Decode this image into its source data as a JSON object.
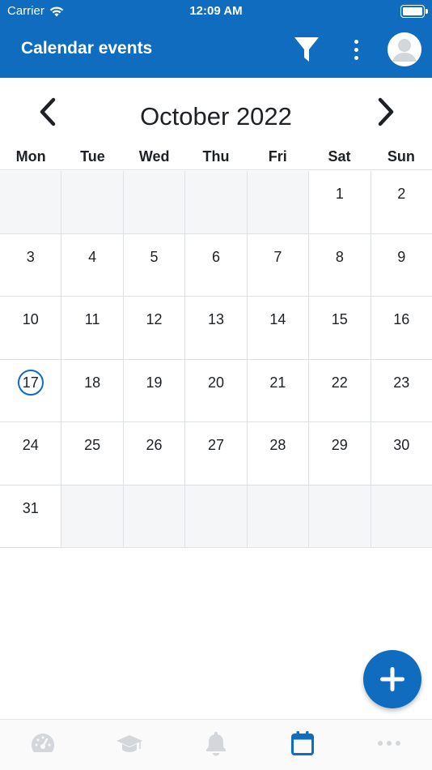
{
  "status_bar": {
    "carrier": "Carrier",
    "time": "12:09 AM"
  },
  "app_bar": {
    "title": "Calendar events",
    "icons": [
      "filter-icon",
      "more-vertical-icon",
      "user-avatar"
    ]
  },
  "calendar": {
    "month_label": "October 2022",
    "weekdays": [
      "Mon",
      "Tue",
      "Wed",
      "Thu",
      "Fri",
      "Sat",
      "Sun"
    ],
    "weeks": [
      [
        "",
        "",
        "",
        "",
        "",
        "1",
        "2"
      ],
      [
        "3",
        "4",
        "5",
        "6",
        "7",
        "8",
        "9"
      ],
      [
        "10",
        "11",
        "12",
        "13",
        "14",
        "15",
        "16"
      ],
      [
        "17",
        "18",
        "19",
        "20",
        "21",
        "22",
        "23"
      ],
      [
        "24",
        "25",
        "26",
        "27",
        "28",
        "29",
        "30"
      ],
      [
        "31",
        "",
        "",
        "",
        "",
        "",
        ""
      ]
    ],
    "today": "17"
  },
  "tab_bar": {
    "tabs": [
      "dashboard-icon",
      "courses-icon",
      "notifications-icon",
      "calendar-icon",
      "more-icon"
    ],
    "active": "calendar-icon"
  },
  "colors": {
    "brand": "#0f6cbf",
    "tab_inactive": "#d3d6da",
    "empty_cell": "#f5f6f8",
    "grid_line": "#dee2e6"
  }
}
